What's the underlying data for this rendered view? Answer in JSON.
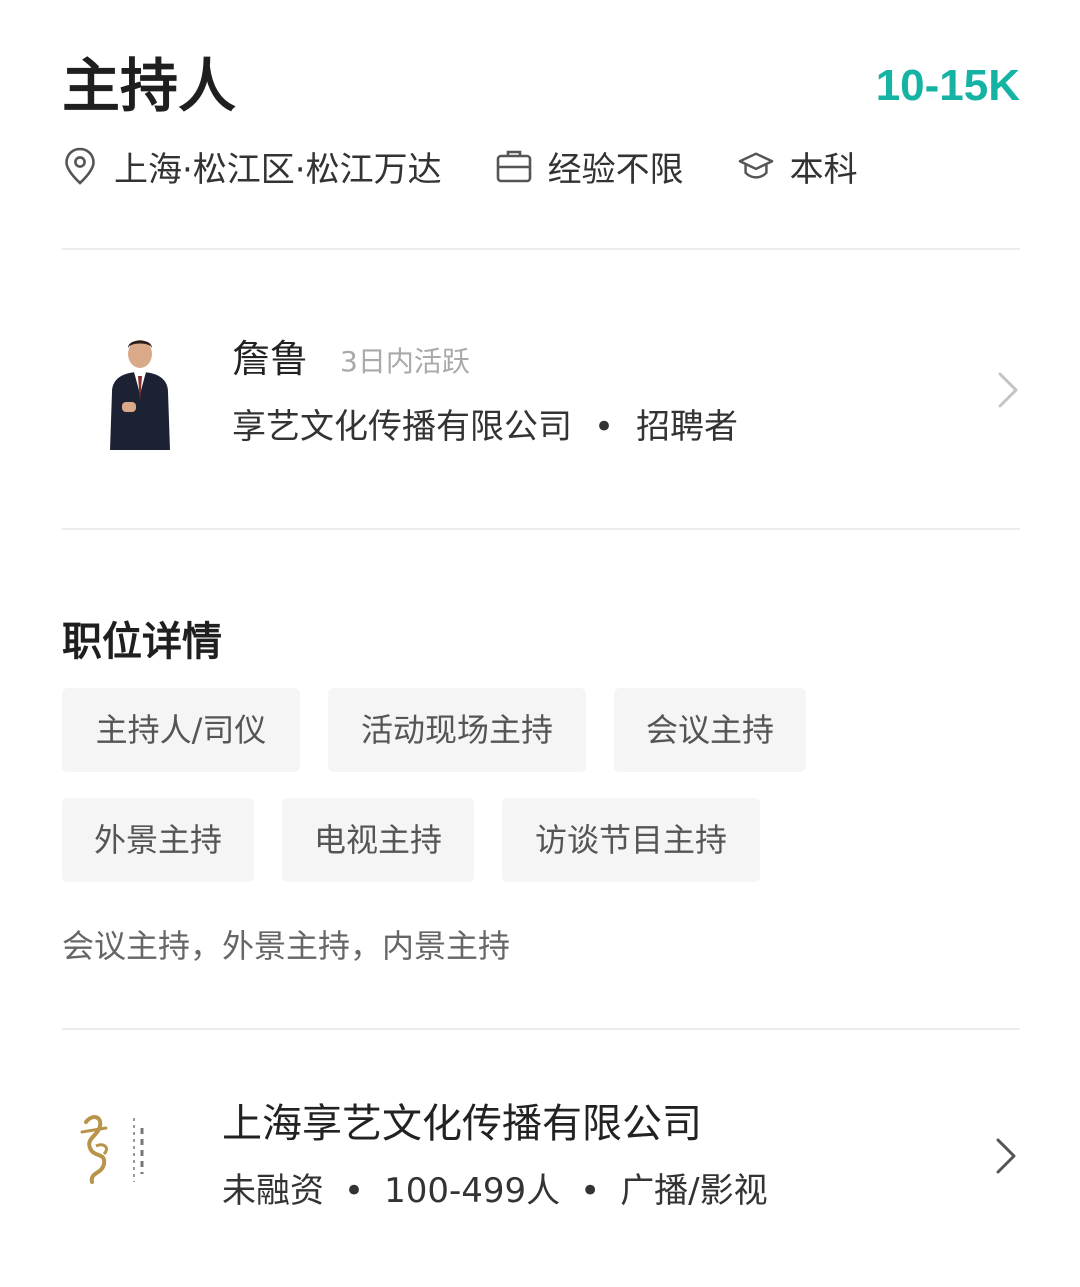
{
  "job": {
    "title": "主持人",
    "salary": "10-15K",
    "location": "上海·松江区·松江万达",
    "experience": "经验不限",
    "education": "本科"
  },
  "recruiter": {
    "name": "詹鲁",
    "active": "3日内活跃",
    "company": "享艺文化传播有限公司",
    "separator": "•",
    "role": "招聘者"
  },
  "details": {
    "title": "职位详情",
    "tags": [
      "主持人/司仪",
      "活动现场主持",
      "会议主持",
      "外景主持",
      "电视主持",
      "访谈节目主持"
    ],
    "description": "会议主持，外景主持，内景主持"
  },
  "company": {
    "name": "上海享艺文化传播有限公司",
    "funding": "未融资",
    "size": "100-499人",
    "industry": "广播/影视",
    "separator": "•"
  },
  "colors": {
    "salary": "#15b3a3",
    "tag_bg": "#f5f5f5"
  },
  "icons": {
    "location": "location-pin-icon",
    "experience": "briefcase-icon",
    "education": "graduation-cap-icon",
    "chevron": "chevron-right-icon"
  }
}
